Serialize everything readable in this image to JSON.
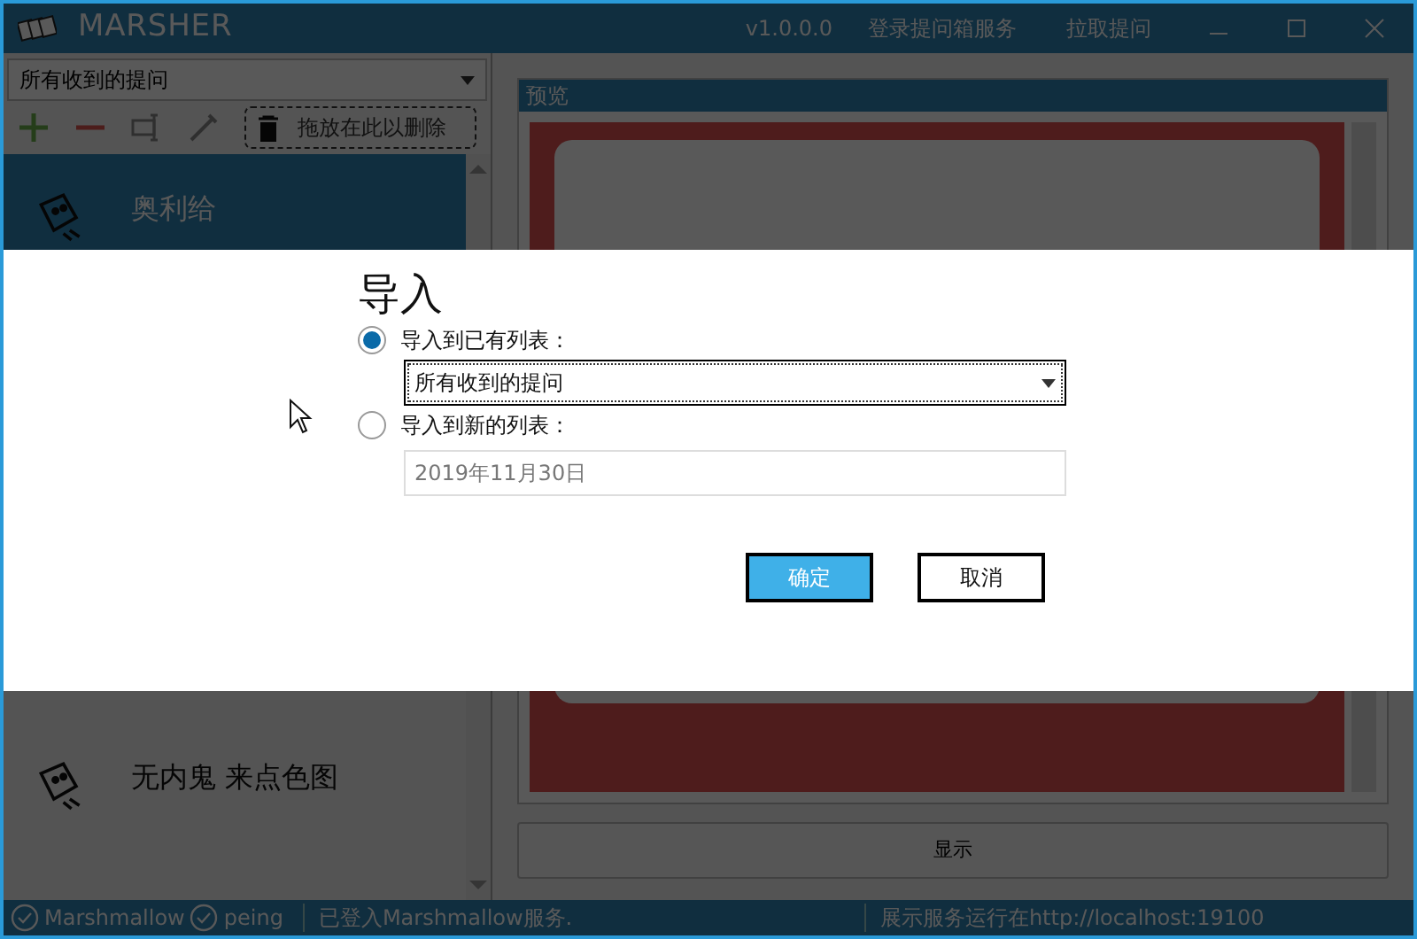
{
  "window": {
    "title": "MARSHER",
    "version": "v1.0.0.0",
    "menu": [
      {
        "label": "登录提问箱服务"
      },
      {
        "label": "拉取提问"
      }
    ]
  },
  "sidebar": {
    "list_selector": "所有收到的提问",
    "drop_zone": "拖放在此以删除",
    "items": [
      {
        "text": "奥利给",
        "selected": true
      },
      {
        "text": "无内鬼 来点色图",
        "selected": false
      }
    ]
  },
  "preview": {
    "title": "预览",
    "show_button": "显示"
  },
  "dialog": {
    "title": "导入",
    "options": [
      {
        "label": "导入到已有列表：",
        "selected": true,
        "kind": "select",
        "value": "所有收到的提问"
      },
      {
        "label": "导入到新的列表：",
        "selected": false,
        "kind": "text",
        "value": "2019年11月30日"
      }
    ],
    "buttons": [
      {
        "label": "确定",
        "primary": true
      },
      {
        "label": "取消",
        "primary": false
      }
    ]
  },
  "status_bar": {
    "services": [
      {
        "name": "Marshmallow",
        "connected": true
      },
      {
        "name": "peing",
        "connected": true
      }
    ],
    "message": "已登入Marshmallow服务.",
    "server": "展示服务运行在http://localhost:19100"
  }
}
